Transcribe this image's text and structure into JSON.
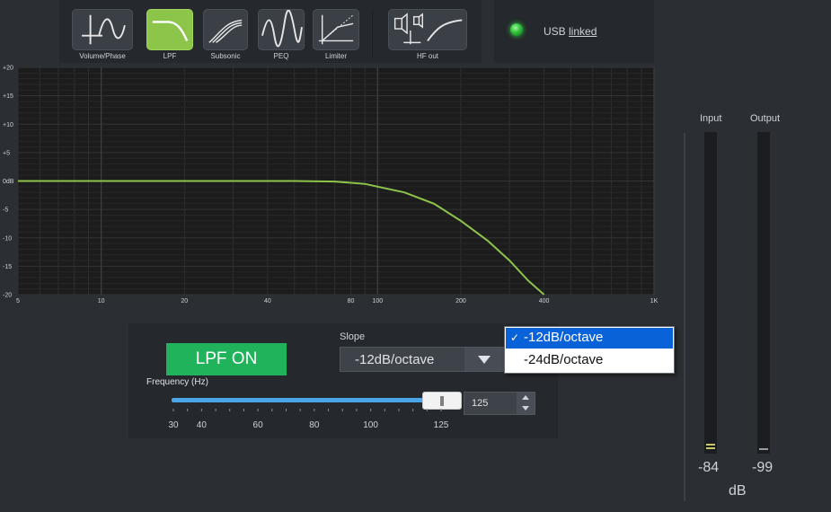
{
  "toolbar": {
    "buttons": [
      {
        "label": "Volume/Phase",
        "icon": "volume-phase-icon",
        "active": false
      },
      {
        "label": "LPF",
        "icon": "lpf-curve-icon",
        "active": true
      },
      {
        "label": "Subsonic",
        "icon": "subsonic-curve-icon",
        "active": false
      },
      {
        "label": "PEQ",
        "icon": "peq-curve-icon",
        "active": false
      },
      {
        "label": "Limiter",
        "icon": "limiter-curve-icon",
        "active": false
      },
      {
        "label": "HF out",
        "icon": "hf-out-icon",
        "active": false
      }
    ]
  },
  "usb": {
    "prefix": "USB ",
    "status": "linked",
    "led_color": "#2fd13e"
  },
  "graph": {
    "y_ticks": [
      "+20",
      "+15",
      "+10",
      "+5",
      "0dB",
      "-5",
      "-10",
      "-15",
      "-20"
    ],
    "x_ticks": [
      "5",
      "10",
      "20",
      "40",
      "80",
      "100",
      "200",
      "400",
      "1K"
    ],
    "curve_color": "#8dc54b",
    "curve": {
      "x": [
        5,
        50,
        70,
        90,
        100,
        125,
        160,
        200,
        250,
        300,
        350,
        400
      ],
      "y": [
        0,
        0,
        -0.1,
        -0.5,
        -1,
        -2,
        -4,
        -7,
        -10.5,
        -14,
        -17.5,
        -20
      ]
    }
  },
  "lpf": {
    "toggle_label": "LPF ON",
    "slope_label": "Slope",
    "slope_value": "-12dB/octave",
    "slope_options": [
      "-12dB/octave",
      "-24dB/octave"
    ],
    "selected_index": 0,
    "check_mark": "✓",
    "frequency_label": "Frequency (Hz)",
    "frequency_value": "125",
    "slider_ticks": [
      "30",
      "40",
      "60",
      "80",
      "100",
      "125"
    ]
  },
  "meters": {
    "input_label": "Input",
    "output_label": "Output",
    "input_value": "-84",
    "output_value": "-99",
    "unit": "dB"
  }
}
